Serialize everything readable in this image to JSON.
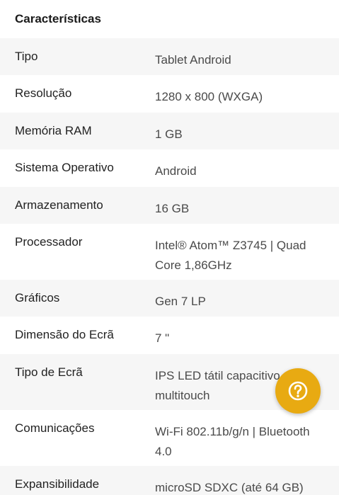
{
  "section": {
    "title": "Características"
  },
  "specs": [
    {
      "label": "Tipo",
      "value": "Tablet Android"
    },
    {
      "label": "Resolução",
      "value": "1280 x 800 (WXGA)"
    },
    {
      "label": "Memória RAM",
      "value": "1 GB"
    },
    {
      "label": "Sistema Operativo",
      "value": "Android"
    },
    {
      "label": "Armazenamento",
      "value": "16 GB"
    },
    {
      "label": "Processador",
      "value": "Intel® Atom™ Z3745 | Quad Core 1,86GHz"
    },
    {
      "label": "Gráficos",
      "value": "Gen 7 LP"
    },
    {
      "label": "Dimensão do Ecrã",
      "value": "7 \""
    },
    {
      "label": "Tipo de Ecrã",
      "value": "IPS LED tátil capacitivo com multitouch"
    },
    {
      "label": "Comunicações",
      "value": "Wi-Fi 802.11b/g/n | Bluetooth 4.0"
    },
    {
      "label": "Expansibilidade",
      "value": "microSD SDXC (até 64 GB)"
    }
  ],
  "help_button": {
    "icon": "question-circle-icon",
    "color": "#e8aa12"
  }
}
